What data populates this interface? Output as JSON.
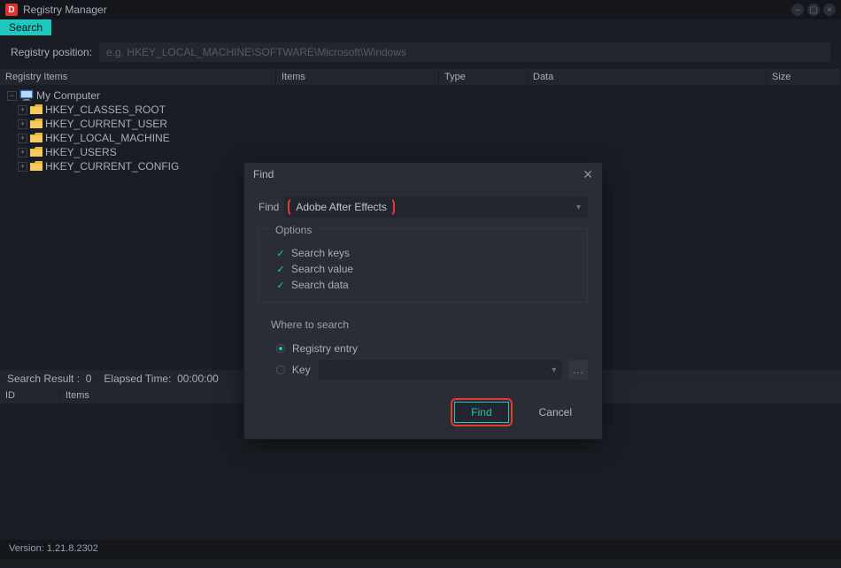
{
  "titlebar": {
    "title": "Registry Manager"
  },
  "search_tab": "Search",
  "position_bar": {
    "label": "Registry position:",
    "placeholder": "e.g. HKEY_LOCAL_MACHINE\\SOFTWARE\\Microsoft\\Windows"
  },
  "columns": {
    "reg_items": "Registry Items",
    "items": "Items",
    "type": "Type",
    "data": "Data",
    "size": "Size"
  },
  "tree": {
    "root": "My Computer",
    "hives": [
      "HKEY_CLASSES_ROOT",
      "HKEY_CURRENT_USER",
      "HKEY_LOCAL_MACHINE",
      "HKEY_USERS",
      "HKEY_CURRENT_CONFIG"
    ]
  },
  "search_result": {
    "label": "Search Result :",
    "count": "0",
    "elapsed_label": "Elapsed Time:",
    "elapsed_value": "00:00:00"
  },
  "result_columns": {
    "id": "ID",
    "items": "Items"
  },
  "status": {
    "version_label": "Version:",
    "version": "1.21.8.2302"
  },
  "dialog": {
    "title": "Find",
    "find_label": "Find",
    "find_value": "Adobe After Effects",
    "options_label": "Options",
    "options": {
      "search_keys": "Search keys",
      "search_value": "Search value",
      "search_data": "Search data"
    },
    "where_label": "Where to search",
    "where_registry": "Registry entry",
    "where_key": "Key",
    "btn_find": "Find",
    "btn_cancel": "Cancel"
  }
}
